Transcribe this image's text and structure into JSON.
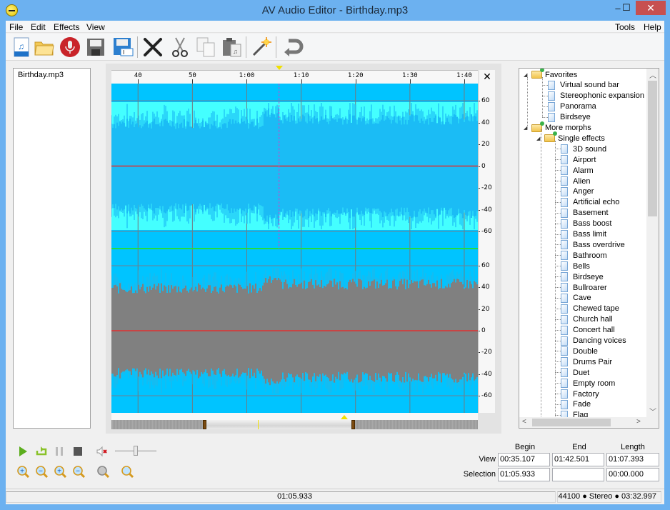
{
  "window": {
    "title": "AV Audio Editor - Birthday.mp3",
    "controls": {
      "minimize": "–",
      "maximize": "☐",
      "close": "✕"
    }
  },
  "menu": {
    "left": [
      "File",
      "Edit",
      "Effects",
      "View"
    ],
    "right": [
      "Tools",
      "Help"
    ]
  },
  "toolbar": {
    "buttons": [
      "new-file-icon",
      "open-folder-icon",
      "record-icon",
      "save-icon",
      "save-as-icon",
      "delete-icon",
      "cut-icon",
      "copy-icon",
      "paste-icon",
      "effects-wand-icon",
      "undo-icon"
    ]
  },
  "files": [
    "Birthday.mp3"
  ],
  "waveform": {
    "time_ticks": [
      "40",
      "50",
      "1:00",
      "1:10",
      "1:20",
      "1:30",
      "1:40"
    ],
    "db_ticks_upper": [
      "60",
      "40",
      "20",
      "0",
      "-20",
      "-40",
      "-60"
    ],
    "db_ticks_lower": [
      "60",
      "40",
      "20",
      "0",
      "-20",
      "-40",
      "-60"
    ],
    "view_begin_s": 35.107,
    "view_end_s": 102.501,
    "cursor_s": 65.933,
    "total_s": 212.997,
    "colors": {
      "background": "#00c4ff",
      "selected_channel": "#44ffff",
      "lower_channel_fill": "#808080",
      "zero_line": "#e03030",
      "channel_divider": "#22dd44",
      "cursor": "#cc44cc"
    },
    "close_label": "✕"
  },
  "effects_tree": {
    "groups": [
      {
        "label": "Favorites",
        "items": [
          "Virtual sound bar",
          "Stereophonic expansion",
          "Panorama",
          "Birdseye"
        ]
      },
      {
        "label": "More morphs",
        "subgroup": {
          "label": "Single effects",
          "items": [
            "3D sound",
            "Airport",
            "Alarm",
            "Alien",
            "Anger",
            "Artificial echo",
            "Basement",
            "Bass boost",
            "Bass limit",
            "Bass overdrive",
            "Bathroom",
            "Bells",
            "Birdseye",
            "Bullroarer",
            "Cave",
            "Chewed tape",
            "Church hall",
            "Concert hall",
            "Dancing voices",
            "Double",
            "Drums Pair",
            "Duet",
            "Empty room",
            "Factory",
            "Fade",
            "Flag"
          ]
        }
      }
    ]
  },
  "transport": {
    "buttons": [
      "play-icon",
      "loop-icon",
      "pause-icon",
      "stop-icon",
      "mute-icon"
    ],
    "volume_fraction": 0.5,
    "zoom_buttons": [
      "zoom-in-horizontal-icon",
      "zoom-out-horizontal-icon",
      "zoom-in-vertical-icon",
      "zoom-out-vertical-icon",
      "zoom-fit-icon",
      "zoom-selection-icon"
    ]
  },
  "time_panel": {
    "headers": [
      "Begin",
      "End",
      "Length"
    ],
    "rows": [
      {
        "label": "View",
        "begin": "00:35.107",
        "end": "01:42.501",
        "length": "01:07.393"
      },
      {
        "label": "Selection",
        "begin": "01:05.933",
        "end": "",
        "length": "00:00.000"
      }
    ]
  },
  "status": {
    "position": "01:05.933",
    "info": "44100 ● Stereo ● 03:32.997"
  }
}
